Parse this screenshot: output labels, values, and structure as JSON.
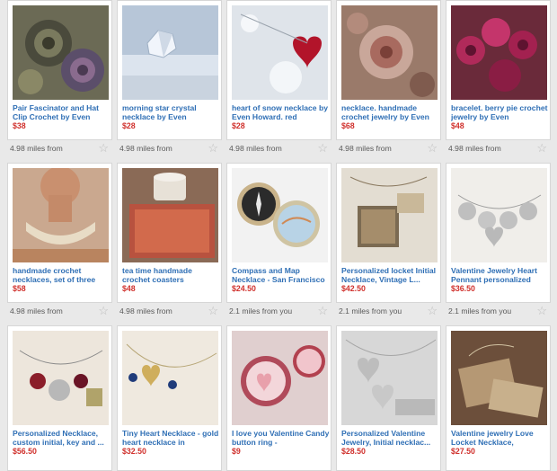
{
  "listings": [
    {
      "title": "Pair Fascinator and Hat Clip Crochet by Even",
      "price": "$38",
      "distance": "4.98 miles from",
      "thumb": "flower-brooches"
    },
    {
      "title": "morning star crystal necklace by Even",
      "price": "$28",
      "distance": "4.98 miles from",
      "thumb": "crystal-snow"
    },
    {
      "title": "heart of snow necklace by Even Howard. red",
      "price": "$28",
      "distance": "4.98 miles from",
      "thumb": "heart-snow"
    },
    {
      "title": "necklace. handmade crochet jewelry by Even",
      "price": "$68",
      "distance": "4.98 miles from",
      "thumb": "crochet-necklace"
    },
    {
      "title": "bracelet. berry pie crochet jewelry by Even",
      "price": "$48",
      "distance": "4.98 miles from",
      "thumb": "berry-bracelet"
    },
    {
      "title": "handmade crochet necklaces, set of three",
      "price": "$58",
      "distance": "4.98 miles from",
      "thumb": "neck-crochet"
    },
    {
      "title": "tea time handmade crochet coasters",
      "price": "$48",
      "distance": "4.98 miles from",
      "thumb": "coasters"
    },
    {
      "title": "Compass and Map Necklace - San Francisco",
      "price": "$24.50",
      "distance": "2.1 miles from you",
      "thumb": "compass-map"
    },
    {
      "title": "Personalized locket Initial Necklace, Vintage L...",
      "price": "$42.50",
      "distance": "2.1 miles from you",
      "thumb": "locket"
    },
    {
      "title": "Valentine Jewelry Heart Pennant personalized",
      "price": "$36.50",
      "distance": "2.1 miles from you",
      "thumb": "heart-pennant"
    },
    {
      "title": "Personalized Necklace, custom initial, key and ...",
      "price": "$56.50",
      "distance": "",
      "thumb": "key-charm"
    },
    {
      "title": "Tiny Heart Necklace - gold heart necklace in",
      "price": "$32.50",
      "distance": "",
      "thumb": "tiny-heart"
    },
    {
      "title": "I love you Valentine Candy button ring -",
      "price": "$9",
      "distance": "",
      "thumb": "candy-rings"
    },
    {
      "title": "Personalized Valentine Jewelry, Initial necklac...",
      "price": "$28.50",
      "distance": "",
      "thumb": "initial-hearts"
    },
    {
      "title": "Valentine jewelry Love Locket Necklace,",
      "price": "$27.50",
      "distance": "",
      "thumb": "love-locket"
    }
  ],
  "star_icon": "star-icon"
}
